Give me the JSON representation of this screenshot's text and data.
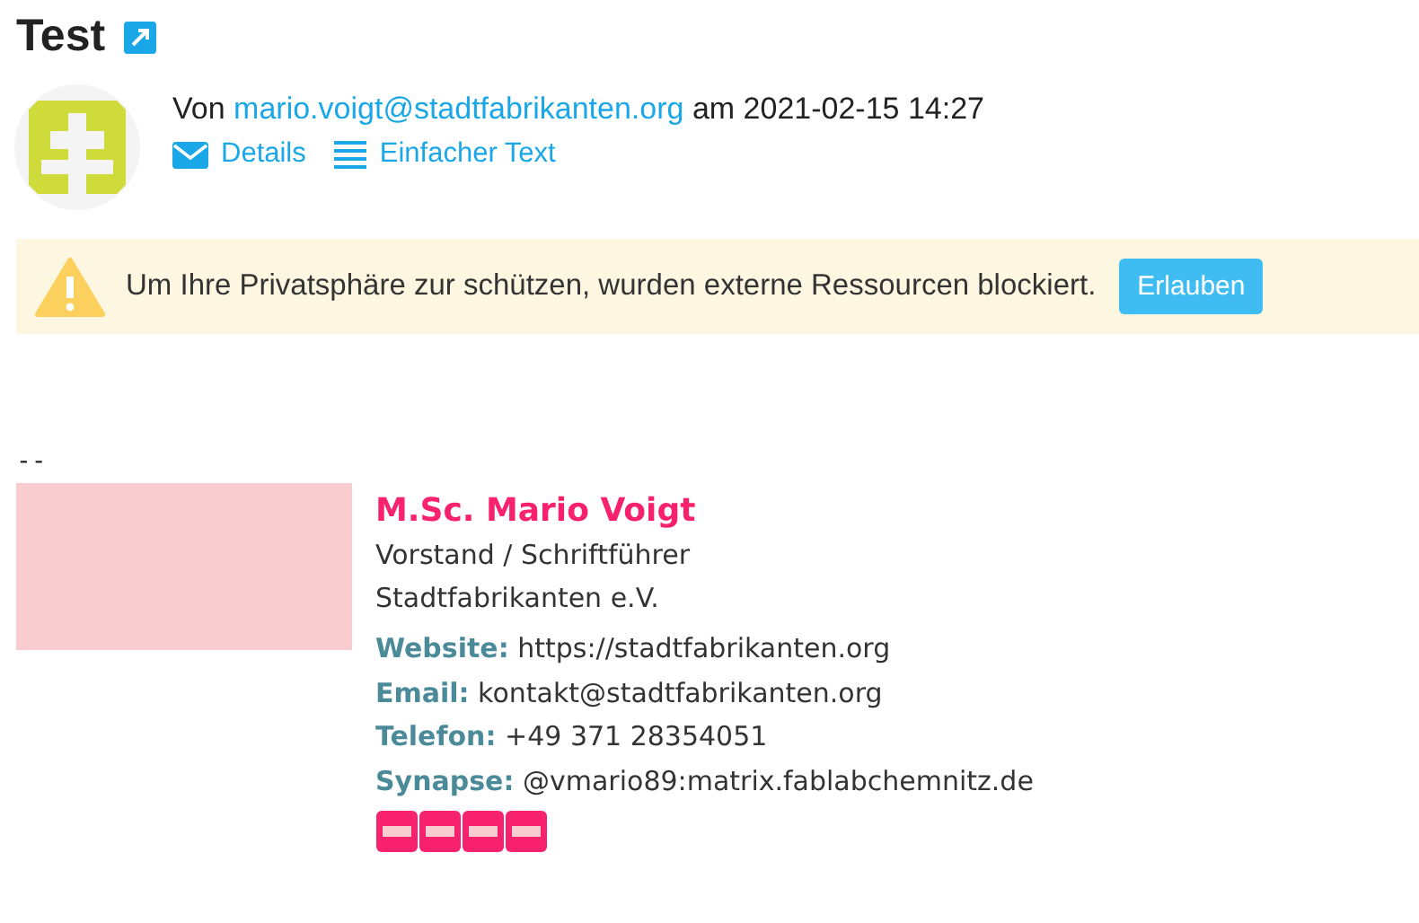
{
  "title": "Test",
  "sender": {
    "prefix": "Von",
    "email": "mario.voigt@stadtfabrikanten.org",
    "date_prefix": "am",
    "date": "2021-02-15 14:27"
  },
  "actions": [
    {
      "kind": "details",
      "label": "Details"
    },
    {
      "kind": "plain",
      "label": "Einfacher Text"
    }
  ],
  "privacy_banner": {
    "message": "Um Ihre Privatsphäre zur schützen, wurden externe Ressourcen blockiert.",
    "button": "Erlauben"
  },
  "body": {
    "separator": "--",
    "signature": {
      "name": "M.Sc. Mario Voigt",
      "lines": [
        "Vorstand / Schriftführer",
        "Stadtfabrikanten e.V."
      ],
      "fields": [
        {
          "label": "Website:",
          "value": "https://stadtfabrikanten.org"
        },
        {
          "label": "Email:",
          "value": "kontakt@stadtfabrikanten.org"
        },
        {
          "label": "Telefon:",
          "value": "+49 371 28354051"
        },
        {
          "label": "Synapse:",
          "value": "@vmario89:matrix.fablabchemnitz.de"
        }
      ],
      "social_links": [
        {
          "kind": "blocked_image"
        },
        {
          "kind": "blocked_image"
        },
        {
          "kind": "blocked_image"
        },
        {
          "kind": "blocked_image"
        }
      ]
    }
  }
}
